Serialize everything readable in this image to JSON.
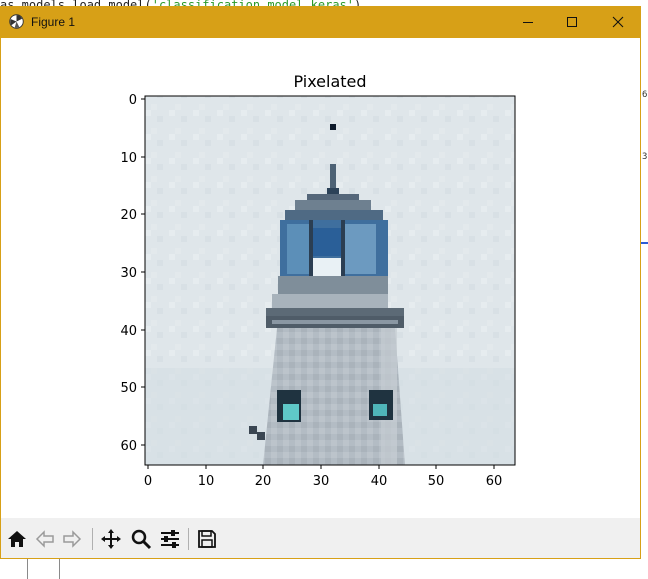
{
  "background": {
    "code_prefix": "as.models.load_model(",
    "code_string": "'classification_model.keras'",
    "code_suffix": ")",
    "right_digits": [
      "6",
      "3"
    ]
  },
  "window": {
    "title": "Figure 1",
    "title_bar_color": "#d7a017",
    "icons": {
      "app": "matplotlib-icon",
      "minimize": "minimize-icon",
      "maximize": "maximize-icon",
      "close": "close-icon"
    }
  },
  "figure": {
    "title": "Pixelated",
    "x_ticks": [
      "0",
      "10",
      "20",
      "30",
      "40",
      "50",
      "60"
    ],
    "y_ticks": [
      "0",
      "10",
      "20",
      "30",
      "40",
      "50",
      "60"
    ]
  },
  "chart_data": {
    "type": "heatmap",
    "title": "Pixelated",
    "xlabel": "",
    "ylabel": "",
    "xlim": [
      -0.5,
      63.5
    ],
    "ylim": [
      63.5,
      -0.5
    ],
    "x_ticks": [
      0,
      10,
      20,
      30,
      40,
      50,
      60
    ],
    "y_ticks": [
      0,
      10,
      20,
      30,
      40,
      50,
      60
    ],
    "image_size": [
      64,
      64
    ],
    "subject": "lighthouse top against cloudy sky",
    "sky_color": "#dfe6ea"
  },
  "toolbar": {
    "buttons": [
      "home-icon",
      "back-icon",
      "forward-icon",
      "pan-icon",
      "zoom-icon",
      "configure-subplots-icon",
      "save-icon"
    ]
  }
}
